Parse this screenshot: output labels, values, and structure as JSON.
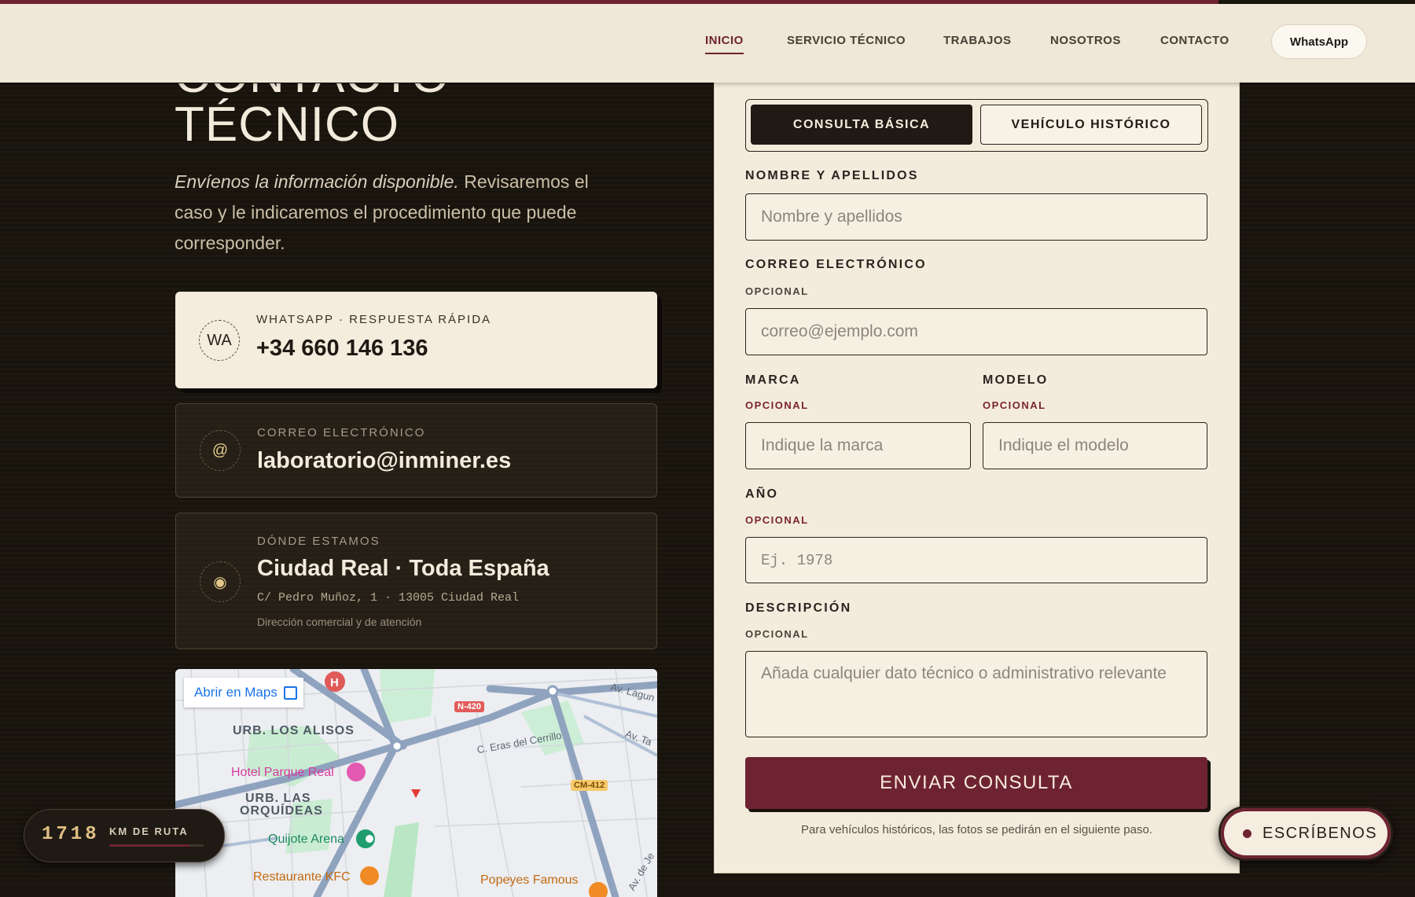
{
  "nav": {
    "items": [
      "INICIO",
      "SERVICIO TÉCNICO",
      "TRABAJOS",
      "NOSOTROS",
      "CONTACTO"
    ],
    "active": "INICIO",
    "whatsapp": "WhatsApp"
  },
  "hero": {
    "title_line1": "CONTACTO",
    "title_line2": "TÉCNICO",
    "intro_em": "Envíenos la información disponible.",
    "intro_rest": " Revisaremos el caso y le indicaremos el procedimiento que puede corresponder."
  },
  "cards": {
    "whatsapp": {
      "badge": "WA",
      "kicker": "WHATSAPP · RESPUESTA RÁPIDA",
      "value": "+34 660 146 136"
    },
    "email": {
      "badge": "@",
      "kicker": "CORREO ELECTRÓNICO",
      "value": "laboratorio@inminer.es"
    },
    "location": {
      "badge": "◉",
      "kicker": "DÓNDE ESTAMOS",
      "value": "Ciudad Real · Toda España",
      "address": "C/ Pedro Muñoz, 1 · 13005 Ciudad Real",
      "note": "Dirección comercial y de atención"
    }
  },
  "map": {
    "open_link": "Abrir en Maps",
    "labels": {
      "alisos": "URB. LOS ALISOS",
      "orquideas_1": "URB. LAS",
      "orquideas_2": "ORQUÍDEAS"
    },
    "pois": {
      "hotel": "Hotel Parque Real",
      "arena": "Quijote Arena",
      "kfc": "Restaurante KFC",
      "popeyes": "Popeyes Famous"
    },
    "roads": {
      "n420": "N-420",
      "cm412": "CM-412",
      "eras": "C. Eras del Cerrillo",
      "laguna": "Av. Lagun",
      "av_ta": "Av. Ta",
      "av_de_je": "Av. de Je"
    }
  },
  "route": {
    "km": "1718",
    "label": "KM DE RUTA",
    "progress": 0.85
  },
  "form": {
    "tabs": [
      "CONSULTA BÁSICA",
      "VEHÍCULO HISTÓRICO"
    ],
    "active_tab": "CONSULTA BÁSICA",
    "name": {
      "label": "NOMBRE Y APELLIDOS",
      "placeholder": "Nombre y apellidos"
    },
    "email": {
      "label": "CORREO ELECTRÓNICO",
      "optional": "OPCIONAL",
      "placeholder": "correo@ejemplo.com"
    },
    "brand": {
      "label": "MARCA",
      "optional": "OPCIONAL",
      "placeholder": "Indique la marca"
    },
    "model": {
      "label": "MODELO",
      "optional": "OPCIONAL",
      "placeholder": "Indique el modelo"
    },
    "year": {
      "label": "AÑO",
      "optional": "OPCIONAL",
      "placeholder": "Ej. 1978"
    },
    "description": {
      "label": "DESCRIPCIÓN",
      "optional": "OPCIONAL",
      "placeholder": "Añada cualquier dato técnico o administrativo relevante"
    },
    "submit": "ENVIAR CONSULTA",
    "note": "Para vehículos históricos, las fotos se pedirán en el siguiente paso."
  },
  "chat_button": "ESCRÍBENOS",
  "colors": {
    "accent": "#6e2332",
    "panel": "#f3ecdd",
    "background": "#1a150f",
    "gold": "#e0c084"
  }
}
